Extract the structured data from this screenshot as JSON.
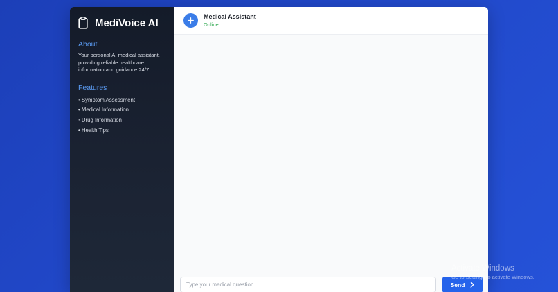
{
  "brand": {
    "title": "MediVoice AI",
    "icon": "clipboard-icon"
  },
  "sidebar": {
    "about_title": "About",
    "about_text": "Your personal AI medical assistant, providing reliable healthcare information and guidance 24/7.",
    "features_title": "Features",
    "features": [
      "• Symptom Assessment",
      "• Medical Information",
      "• Drug Information",
      "• Health Tips"
    ]
  },
  "chat": {
    "assistant_name": "Medical Assistant",
    "status": "Online",
    "avatar_icon": "plus-icon",
    "input_placeholder": "Type your medical question...",
    "send_label": "Send",
    "send_icon": "chevron-right-icon"
  },
  "watermark": {
    "title": "Activate Windows",
    "subtitle": "Go to Settings to activate Windows."
  },
  "colors": {
    "background": "#2148c9",
    "sidebar": "#1b2333",
    "accent": "#2563eb",
    "section_title": "#5b9cf5",
    "status": "#2fa84f"
  }
}
